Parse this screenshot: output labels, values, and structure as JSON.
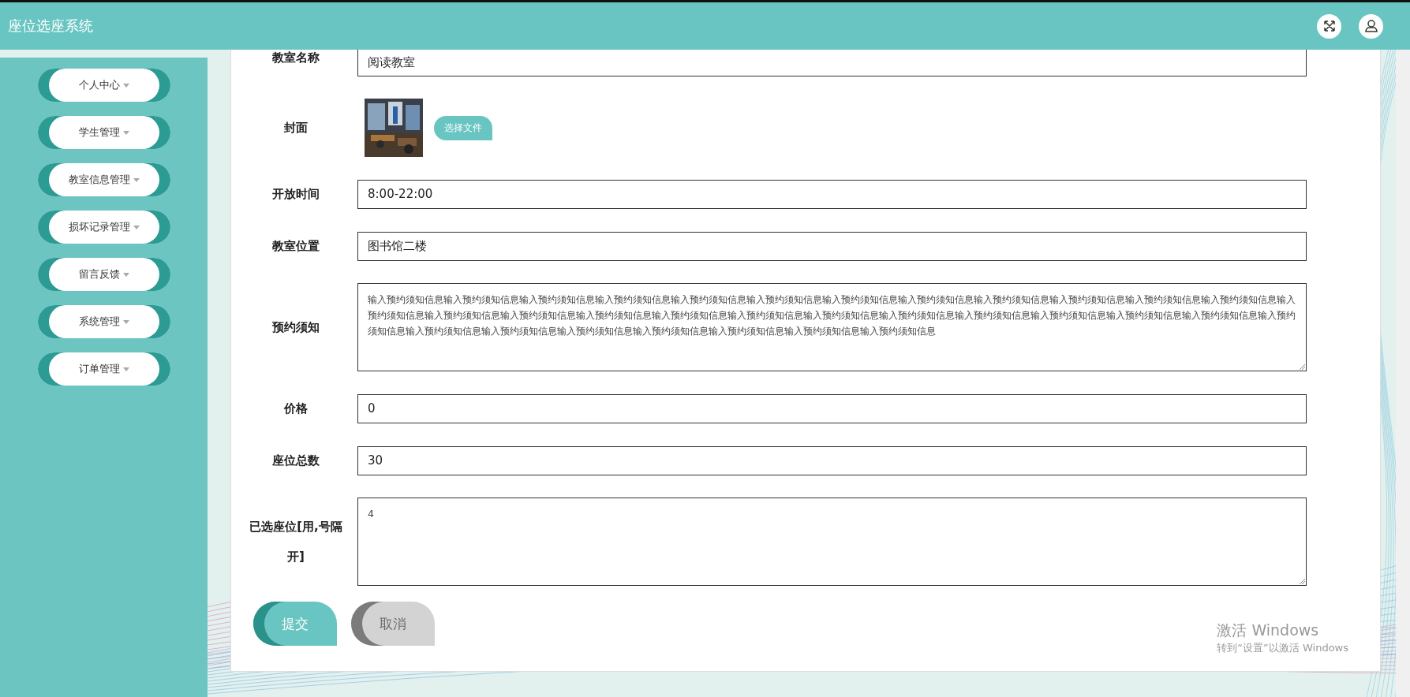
{
  "header": {
    "title": "座位选座系统"
  },
  "sidebar": {
    "items": [
      {
        "label": "个人中心"
      },
      {
        "label": "学生管理"
      },
      {
        "label": "教室信息管理"
      },
      {
        "label": "损坏记录管理"
      },
      {
        "label": "留言反馈"
      },
      {
        "label": "系统管理"
      },
      {
        "label": "订单管理"
      }
    ]
  },
  "form": {
    "fields": [
      {
        "kind": "input",
        "label": "教室名称",
        "value": "阅读教室"
      },
      {
        "label": "封面",
        "button": "选择文件"
      },
      {
        "kind": "input",
        "label": "开放时间",
        "value": "8:00-22:00"
      },
      {
        "kind": "input",
        "label": "教室位置",
        "value": "图书馆二楼"
      },
      {
        "kind": "textarea",
        "label": "预约须知",
        "value": "输入预约须知信息输入预约须知信息输入预约须知信息输入预约须知信息输入预约须知信息输入预约须知信息输入预约须知信息输入预约须知信息输入预约须知信息输入预约须知信息输入预约须知信息输入预约须知信息输入预约须知信息输入预约须知信息输入预约须知信息输入预约须知信息输入预约须知信息输入预约须知信息输入预约须知信息输入预约须知信息输入预约须知信息输入预约须知信息输入预约须知信息输入预约须知信息输入预约须知信息输入预约须知信息输入预约须知信息输入预约须知信息输入预约须知信息输入预约须知信息输入预约须知信息输入预约须知信息"
      },
      {
        "kind": "input",
        "label": "价格",
        "value": "0"
      },
      {
        "kind": "input",
        "label": "座位总数",
        "value": "30"
      },
      {
        "kind": "textarea",
        "label": "已选座位[用,号隔开]",
        "value": "4"
      }
    ],
    "buttons": [
      {
        "kind": "primary",
        "label": "提交"
      },
      {
        "kind": "secondary",
        "label": "取消"
      }
    ]
  },
  "os_notice": {
    "title": "激活 Windows",
    "subtitle": "转到“设置”以激活 Windows"
  }
}
